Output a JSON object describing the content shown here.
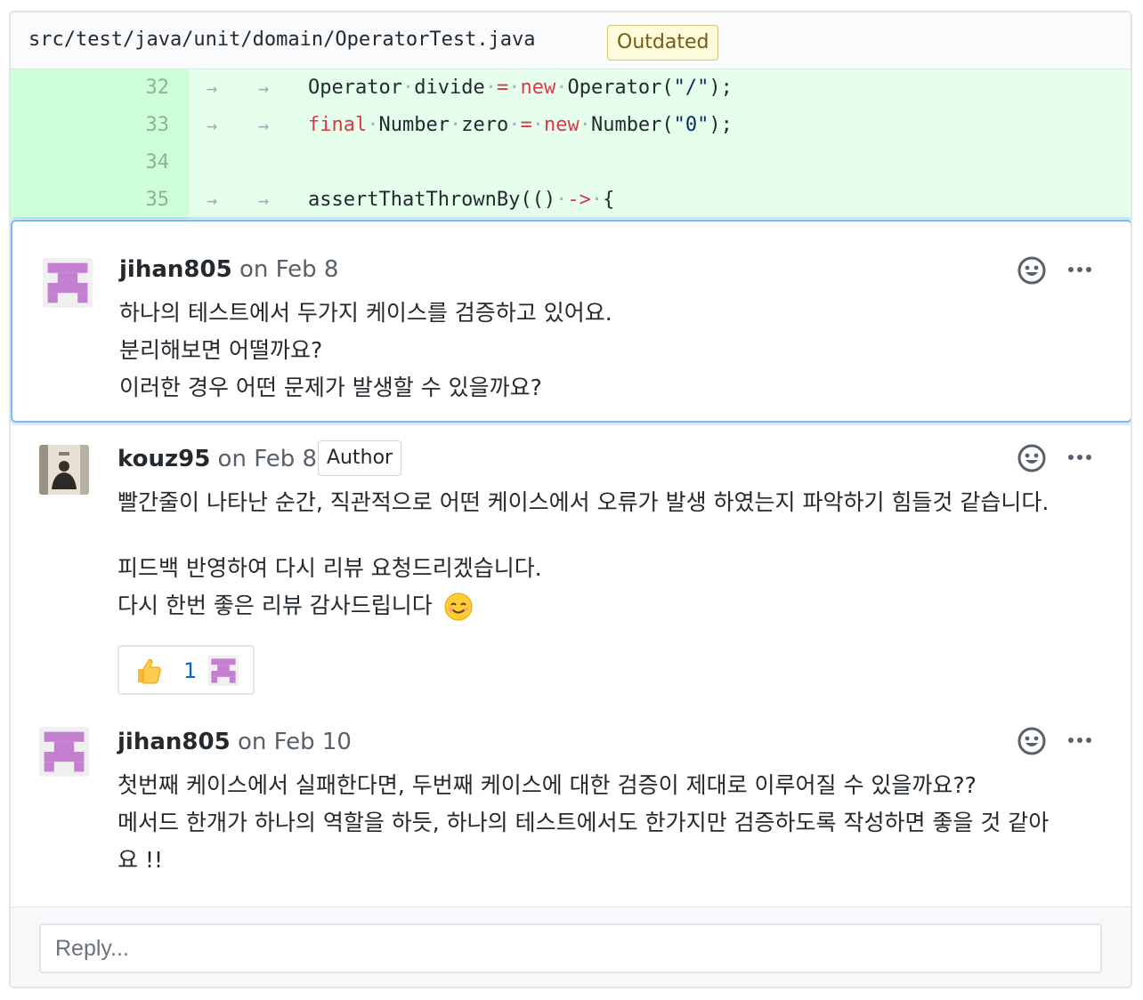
{
  "file": {
    "path": "src/test/java/unit/domain/OperatorTest.java",
    "status_badge": "Outdated"
  },
  "code_lines": [
    {
      "num": "32",
      "tokens": [
        {
          "t": "Operator",
          "c": "plain"
        },
        {
          "t": "·",
          "c": "ws"
        },
        {
          "t": "divide",
          "c": "plain"
        },
        {
          "t": "·",
          "c": "ws"
        },
        {
          "t": "=",
          "c": "kw"
        },
        {
          "t": "·",
          "c": "ws"
        },
        {
          "t": "new",
          "c": "kw"
        },
        {
          "t": "·",
          "c": "ws"
        },
        {
          "t": "Operator(",
          "c": "plain"
        },
        {
          "t": "\"/\"",
          "c": "str"
        },
        {
          "t": ");",
          "c": "plain"
        }
      ]
    },
    {
      "num": "33",
      "tokens": [
        {
          "t": "final",
          "c": "kw"
        },
        {
          "t": "·",
          "c": "ws"
        },
        {
          "t": "Number",
          "c": "plain"
        },
        {
          "t": "·",
          "c": "ws"
        },
        {
          "t": "zero",
          "c": "plain"
        },
        {
          "t": "·",
          "c": "ws"
        },
        {
          "t": "=",
          "c": "kw"
        },
        {
          "t": "·",
          "c": "ws"
        },
        {
          "t": "new",
          "c": "kw"
        },
        {
          "t": "·",
          "c": "ws"
        },
        {
          "t": "Number(",
          "c": "plain"
        },
        {
          "t": "\"0\"",
          "c": "str"
        },
        {
          "t": ");",
          "c": "plain"
        }
      ]
    },
    {
      "num": "34",
      "tokens": []
    },
    {
      "num": "35",
      "tokens": [
        {
          "t": "assertThatThrownBy(()",
          "c": "plain"
        },
        {
          "t": "·",
          "c": "ws"
        },
        {
          "t": "->",
          "c": "kw"
        },
        {
          "t": "·",
          "c": "ws"
        },
        {
          "t": "{",
          "c": "plain"
        }
      ]
    }
  ],
  "tab_glyph": "→",
  "comments": [
    {
      "author": "jihan805",
      "date": "on Feb 8",
      "lines": [
        "하나의 테스트에서 두가지 케이스를 검증하고 있어요.",
        "분리해보면 어떨까요?",
        "이러한 경우 어떤 문제가 발생할 수 있을까요?"
      ]
    },
    {
      "author": "kouz95",
      "date": "on Feb 8",
      "badge": "Author",
      "lines": [
        "빨간줄이 나타난 순간, 직관적으로 어떤 케이스에서 오류가 발생 하였는지 파악하기 힘들것 같습니다."
      ],
      "lines2": [
        "피드백 반영하여 다시 리뷰 요청드리겠습니다.",
        "다시 한번 좋은 리뷰 감사드립니다"
      ],
      "reaction": {
        "emoji": "thumbs-up",
        "count": "1"
      }
    },
    {
      "author": "jihan805",
      "date": "on Feb 10",
      "lines": [
        "첫번째 케이스에서 실패한다면, 두번째 케이스에 대한 검증이 제대로 이루어질 수 있을까요??",
        "메서드 한개가 하나의 역할을 하듯, 하나의 테스트에서도 한가지만 검증하도록 작성하면 좋을 것 같아",
        "요 !!"
      ]
    }
  ],
  "reply": {
    "placeholder": "Reply..."
  },
  "colors": {
    "identicon": "#c47fd1",
    "added_bg": "#e6ffed",
    "added_gutter": "#cdffd8",
    "highlight_border": "#79b8ff",
    "link": "#0366d6"
  }
}
